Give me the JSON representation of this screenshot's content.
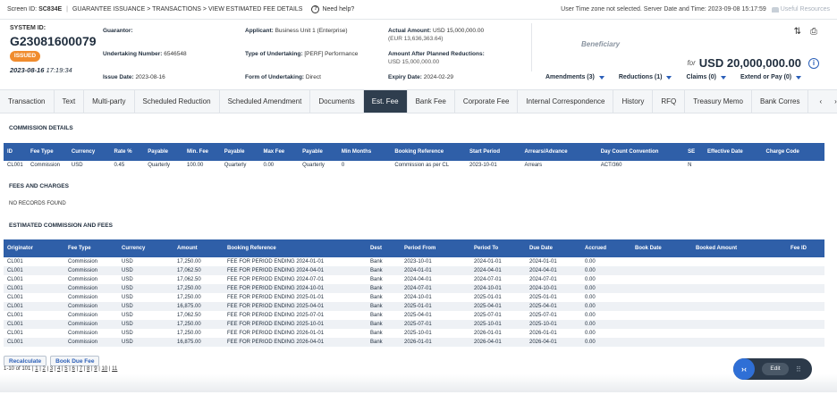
{
  "topbar": {
    "screen_id_label": "Screen ID:",
    "screen_id": "SC834E",
    "breadcrumb": "GUARANTEE ISSUANCE > TRANSACTIONS > VIEW ESTIMATED FEE DETAILS",
    "help": "Need help?",
    "timezone": "User Time zone not selected. Server Date and Time: 2023-09-08 15:17:59",
    "useful": "Useful Resources"
  },
  "header": {
    "system_id_label": "SYSTEM ID:",
    "system_id": "G23081600079",
    "status": "ISSUED",
    "status_date": "2023-08-16",
    "status_time": "17:19:34",
    "guarantor_label": "Guarantor:",
    "guarantor_value": "",
    "undertaking_label": "Undertaking Number:",
    "undertaking_value": "6546548",
    "issue_date_label": "Issue Date:",
    "issue_date_value": "2023-08-16",
    "applicant_label": "Applicant:",
    "applicant_value": "Business Unit 1 (Enterprise)",
    "type_label": "Type of Undertaking:",
    "type_value": "[PERF] Performance",
    "form_label": "Form of Undertaking:",
    "form_value": "Direct",
    "actual_label": "Actual Amount:",
    "actual_value": "USD 15,000,000.00",
    "actual_eur": "(EUR 13,636,363.64)",
    "after_label": "Amount After Planned Reductions:",
    "after_value": "USD 15,000,000.00",
    "expiry_label": "Expiry Date:",
    "expiry_value": "2024-02-29",
    "beneficiary": "Beneficiary",
    "for_label": "for",
    "amount": "USD 20,000,000.00",
    "dropdowns": [
      "Amendments (3)",
      "Reductions (1)",
      "Claims (0)",
      "Extend or Pay (0)"
    ]
  },
  "tabs": [
    "Transaction",
    "Text",
    "Multi-party",
    "Scheduled Reduction",
    "Scheduled Amendment",
    "Documents",
    "Est. Fee",
    "Bank Fee",
    "Corporate Fee",
    "Internal Correspondence",
    "History",
    "RFQ",
    "Treasury Memo",
    "Bank Corres"
  ],
  "active_tab": "Est. Fee",
  "commission": {
    "title": "COMMISSION DETAILS",
    "headers": [
      "ID",
      "Fee Type",
      "Currency",
      "Rate %",
      "Payable",
      "Min. Fee",
      "Payable",
      "Max Fee",
      "Payable",
      "Min Months",
      "Booking Reference",
      "Start Period",
      "Arrears/Advance",
      "Day Count Convention",
      "SE",
      "Effective Date",
      "Charge Code"
    ],
    "rows": [
      [
        "CL001",
        "Commission",
        "USD",
        "0.45",
        "Quarterly",
        "100.00",
        "Quarterly",
        "0.00",
        "Quarterly",
        "0",
        "Commission as per CL",
        "2023-10-01",
        "Arrears",
        "ACT/360",
        "N",
        "",
        ""
      ]
    ]
  },
  "fees": {
    "title": "FEES AND CHARGES",
    "empty": "NO RECORDS FOUND"
  },
  "estimated": {
    "title": "ESTIMATED COMMISSION AND FEES",
    "headers": [
      "Originator",
      "Fee Type",
      "Currency",
      "Amount",
      "Booking Reference",
      "Dest",
      "Period From",
      "Period To",
      "Due Date",
      "Accrued",
      "Book Date",
      "Booked Amount",
      "Fee ID"
    ],
    "rows": [
      [
        "CL001",
        "Commission",
        "USD",
        "17,250.00",
        "FEE FOR PERIOD ENDING 2024-01-01",
        "Bank",
        "2023-10-01",
        "2024-01-01",
        "2024-01-01",
        "0.00",
        "",
        "",
        ""
      ],
      [
        "CL001",
        "Commission",
        "USD",
        "17,062.50",
        "FEE FOR PERIOD ENDING 2024-04-01",
        "Bank",
        "2024-01-01",
        "2024-04-01",
        "2024-04-01",
        "0.00",
        "",
        "",
        ""
      ],
      [
        "CL001",
        "Commission",
        "USD",
        "17,062.50",
        "FEE FOR PERIOD ENDING 2024-07-01",
        "Bank",
        "2024-04-01",
        "2024-07-01",
        "2024-07-01",
        "0.00",
        "",
        "",
        ""
      ],
      [
        "CL001",
        "Commission",
        "USD",
        "17,250.00",
        "FEE FOR PERIOD ENDING 2024-10-01",
        "Bank",
        "2024-07-01",
        "2024-10-01",
        "2024-10-01",
        "0.00",
        "",
        "",
        ""
      ],
      [
        "CL001",
        "Commission",
        "USD",
        "17,250.00",
        "FEE FOR PERIOD ENDING 2025-01-01",
        "Bank",
        "2024-10-01",
        "2025-01-01",
        "2025-01-01",
        "0.00",
        "",
        "",
        ""
      ],
      [
        "CL001",
        "Commission",
        "USD",
        "16,875.00",
        "FEE FOR PERIOD ENDING 2025-04-01",
        "Bank",
        "2025-01-01",
        "2025-04-01",
        "2025-04-01",
        "0.00",
        "",
        "",
        ""
      ],
      [
        "CL001",
        "Commission",
        "USD",
        "17,062.50",
        "FEE FOR PERIOD ENDING 2025-07-01",
        "Bank",
        "2025-04-01",
        "2025-07-01",
        "2025-07-01",
        "0.00",
        "",
        "",
        ""
      ],
      [
        "CL001",
        "Commission",
        "USD",
        "17,250.00",
        "FEE FOR PERIOD ENDING 2025-10-01",
        "Bank",
        "2025-07-01",
        "2025-10-01",
        "2025-10-01",
        "0.00",
        "",
        "",
        ""
      ],
      [
        "CL001",
        "Commission",
        "USD",
        "17,250.00",
        "FEE FOR PERIOD ENDING 2026-01-01",
        "Bank",
        "2025-10-01",
        "2026-01-01",
        "2026-01-01",
        "0.00",
        "",
        "",
        ""
      ],
      [
        "CL001",
        "Commission",
        "USD",
        "16,875.00",
        "FEE FOR PERIOD ENDING 2026-04-01",
        "Bank",
        "2026-01-01",
        "2026-04-01",
        "2026-04-01",
        "0.00",
        "",
        "",
        ""
      ]
    ]
  },
  "actions": {
    "recalculate": "Recalculate",
    "book_due_fee": "Book Due Fee"
  },
  "pager": {
    "range": "1-10 of 101",
    "pages": [
      "1",
      "2",
      "3",
      "4",
      "5",
      "6",
      "7",
      "8",
      "9",
      "10",
      "11"
    ]
  },
  "float": {
    "edit": "Edit"
  }
}
